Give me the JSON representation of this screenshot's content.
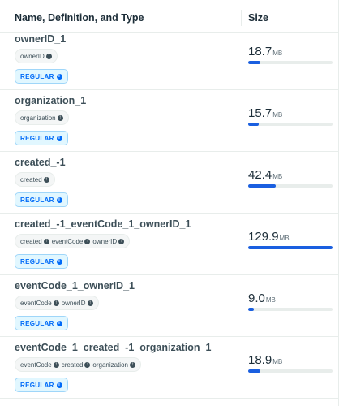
{
  "header": {
    "name_label": "Name, Definition, and Type",
    "size_label": "Size"
  },
  "colors": {
    "bar_fill": "#1a5fe0",
    "bar_track": "#e8edeb",
    "badge_text": "#016bf8",
    "badge_bg": "#e1f7ff"
  },
  "size_unit": "MB",
  "indexes": [
    {
      "name": "ownerID_1",
      "fields": [
        "ownerID"
      ],
      "type": "REGULAR",
      "size_value": "18.7",
      "size_fraction": 0.144
    },
    {
      "name": "organization_1",
      "fields": [
        "organization"
      ],
      "type": "REGULAR",
      "size_value": "15.7",
      "size_fraction": 0.121
    },
    {
      "name": "created_-1",
      "fields": [
        "created"
      ],
      "type": "REGULAR",
      "size_value": "42.4",
      "size_fraction": 0.326
    },
    {
      "name": "created_-1_eventCode_1_ownerID_1",
      "fields": [
        "created",
        "eventCode",
        "ownerID"
      ],
      "type": "REGULAR",
      "size_value": "129.9",
      "size_fraction": 1.0
    },
    {
      "name": "eventCode_1_ownerID_1",
      "fields": [
        "eventCode",
        "ownerID"
      ],
      "type": "REGULAR",
      "size_value": "9.0",
      "size_fraction": 0.069
    },
    {
      "name": "eventCode_1_created_-1_organization_1",
      "fields": [
        "eventCode",
        "created",
        "organization"
      ],
      "type": "REGULAR",
      "size_value": "18.9",
      "size_fraction": 0.146
    }
  ]
}
